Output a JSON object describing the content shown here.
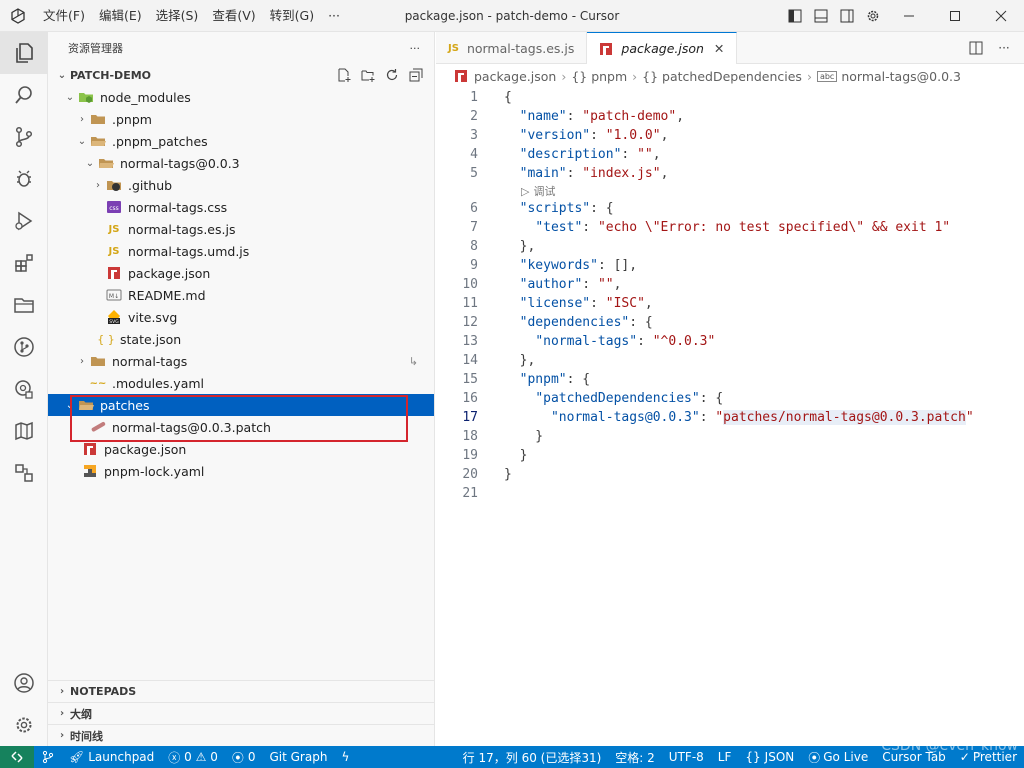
{
  "window": {
    "title": "package.json - patch-demo - Cursor",
    "menu": [
      "文件(F)",
      "编辑(E)",
      "选择(S)",
      "查看(V)",
      "转到(G)",
      "···"
    ]
  },
  "sidebar": {
    "header_title": "资源管理器",
    "more": "···",
    "section_title": "PATCH-DEMO",
    "tree": [
      {
        "label": "node_modules",
        "chevron": "open"
      },
      {
        "label": ".pnpm",
        "chevron": "closed"
      },
      {
        "label": ".pnpm_patches",
        "chevron": "open"
      },
      {
        "label": "normal-tags@0.0.3",
        "chevron": "open"
      },
      {
        "label": ".github",
        "chevron": "closed"
      },
      {
        "label": "normal-tags.css"
      },
      {
        "label": "normal-tags.es.js"
      },
      {
        "label": "normal-tags.umd.js"
      },
      {
        "label": "package.json"
      },
      {
        "label": "README.md"
      },
      {
        "label": "vite.svg"
      },
      {
        "label": "state.json"
      },
      {
        "label": "normal-tags",
        "chevron": "closed",
        "decoration": "↳"
      },
      {
        "label": ".modules.yaml"
      },
      {
        "label": "patches",
        "chevron": "open"
      },
      {
        "label": "normal-tags@0.0.3.patch"
      },
      {
        "label": "package.json"
      },
      {
        "label": "pnpm-lock.yaml"
      }
    ],
    "bottom_sections": [
      "NOTEPADS",
      "大纲",
      "时间线"
    ]
  },
  "editor": {
    "tabs": [
      {
        "label": "normal-tags.es.js",
        "icon": "JS"
      },
      {
        "label": "package.json",
        "close": "✕"
      }
    ],
    "breadcrumb": [
      "package.json",
      "{} pnpm",
      "{} patchedDependencies",
      "normal-tags@0.0.3"
    ],
    "codelens": "调试",
    "current_line": 17,
    "lines": [
      "{",
      "  \"name\": \"patch-demo\",",
      "  \"version\": \"1.0.0\",",
      "  \"description\": \"\",",
      "  \"main\": \"index.js\",",
      "  \"scripts\": {",
      "    \"test\": \"echo \\\"Error: no test specified\\\" && exit 1\"",
      "  },",
      "  \"keywords\": [],",
      "  \"author\": \"\",",
      "  \"license\": \"ISC\",",
      "  \"dependencies\": {",
      "    \"normal-tags\": \"^0.0.3\"",
      "  },",
      "  \"pnpm\": {",
      "    \"patchedDependencies\": {",
      "      \"normal-tags@0.0.3\": \"patches/normal-tags@0.0.3.patch\"",
      "    }",
      "  }",
      "}",
      ""
    ]
  },
  "statusbar": {
    "launchpad": "Launchpad",
    "errors": "0",
    "warnings": "0",
    "ports": "0",
    "git_graph": "Git Graph",
    "position": "行 17，列 60 (已选择31)",
    "spaces": "空格: 2",
    "encoding": "UTF-8",
    "eol": "LF",
    "language": "JSON",
    "go_live": "Go Live",
    "cursor_tab": "Cursor Tab",
    "prettier": "Prettier"
  },
  "watermark": "CSDN @even_know",
  "colors": {
    "accent": "#007acc",
    "selection": "#0060c0",
    "highlight_box": "#d4252d"
  }
}
